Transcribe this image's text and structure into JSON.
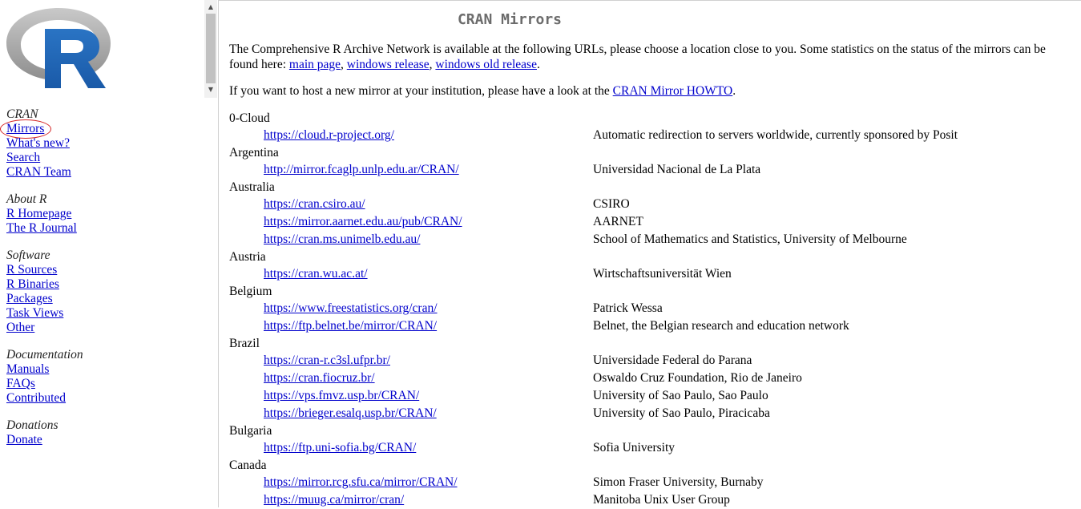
{
  "sidebar": {
    "sections": [
      {
        "heading": "CRAN",
        "links": [
          "Mirrors",
          "What's new?",
          "Search",
          "CRAN Team"
        ]
      },
      {
        "heading": "About R",
        "links": [
          "R Homepage",
          "The R Journal"
        ]
      },
      {
        "heading": "Software",
        "links": [
          "R Sources",
          "R Binaries",
          "Packages",
          "Task Views",
          "Other"
        ]
      },
      {
        "heading": "Documentation",
        "links": [
          "Manuals",
          "FAQs",
          "Contributed"
        ]
      },
      {
        "heading": "Donations",
        "links": [
          "Donate"
        ]
      }
    ],
    "highlighted_link": "Mirrors"
  },
  "main": {
    "title": "CRAN Mirrors",
    "intro1": "The Comprehensive R Archive Network is available at the following URLs, please choose a location close to you. Some statistics on the status of the mirrors can be found here:",
    "intro1_links": [
      "main page",
      "windows release",
      "windows old release"
    ],
    "intro2_prefix": "If you want to host a new mirror at your institution, please have a look at the",
    "intro2_link": "CRAN Mirror HOWTO",
    "mirrors": [
      {
        "country": "0-Cloud",
        "sites": [
          {
            "url": "https://cloud.r-project.org/",
            "desc": "Automatic redirection to servers worldwide, currently sponsored by Posit"
          }
        ]
      },
      {
        "country": "Argentina",
        "sites": [
          {
            "url": "http://mirror.fcaglp.unlp.edu.ar/CRAN/",
            "desc": "Universidad Nacional de La Plata"
          }
        ]
      },
      {
        "country": "Australia",
        "sites": [
          {
            "url": "https://cran.csiro.au/",
            "desc": "CSIRO"
          },
          {
            "url": "https://mirror.aarnet.edu.au/pub/CRAN/",
            "desc": "AARNET"
          },
          {
            "url": "https://cran.ms.unimelb.edu.au/",
            "desc": "School of Mathematics and Statistics, University of Melbourne"
          }
        ]
      },
      {
        "country": "Austria",
        "sites": [
          {
            "url": "https://cran.wu.ac.at/",
            "desc": "Wirtschaftsuniversität Wien"
          }
        ]
      },
      {
        "country": "Belgium",
        "sites": [
          {
            "url": "https://www.freestatistics.org/cran/",
            "desc": "Patrick Wessa"
          },
          {
            "url": "https://ftp.belnet.be/mirror/CRAN/",
            "desc": "Belnet, the Belgian research and education network"
          }
        ]
      },
      {
        "country": "Brazil",
        "sites": [
          {
            "url": "https://cran-r.c3sl.ufpr.br/",
            "desc": "Universidade Federal do Parana"
          },
          {
            "url": "https://cran.fiocruz.br/",
            "desc": "Oswaldo Cruz Foundation, Rio de Janeiro"
          },
          {
            "url": "https://vps.fmvz.usp.br/CRAN/",
            "desc": "University of Sao Paulo, Sao Paulo"
          },
          {
            "url": "https://brieger.esalq.usp.br/CRAN/",
            "desc": "University of Sao Paulo, Piracicaba"
          }
        ]
      },
      {
        "country": "Bulgaria",
        "sites": [
          {
            "url": "https://ftp.uni-sofia.bg/CRAN/",
            "desc": "Sofia University"
          }
        ]
      },
      {
        "country": "Canada",
        "sites": [
          {
            "url": "https://mirror.rcg.sfu.ca/mirror/CRAN/",
            "desc": "Simon Fraser University, Burnaby"
          },
          {
            "url": "https://muug.ca/mirror/cran/",
            "desc": "Manitoba Unix User Group"
          }
        ]
      }
    ]
  },
  "colors": {
    "link": "#0000cc",
    "title": "#6c6c6c",
    "logo_grey": "#a6a6a6",
    "logo_blue": "#1f65b7",
    "highlight_ring": "#d52626"
  },
  "icons": {
    "logo": "r-logo-icon",
    "scroll_up": "scroll-up-arrow-icon",
    "scroll_down": "scroll-down-arrow-icon"
  }
}
